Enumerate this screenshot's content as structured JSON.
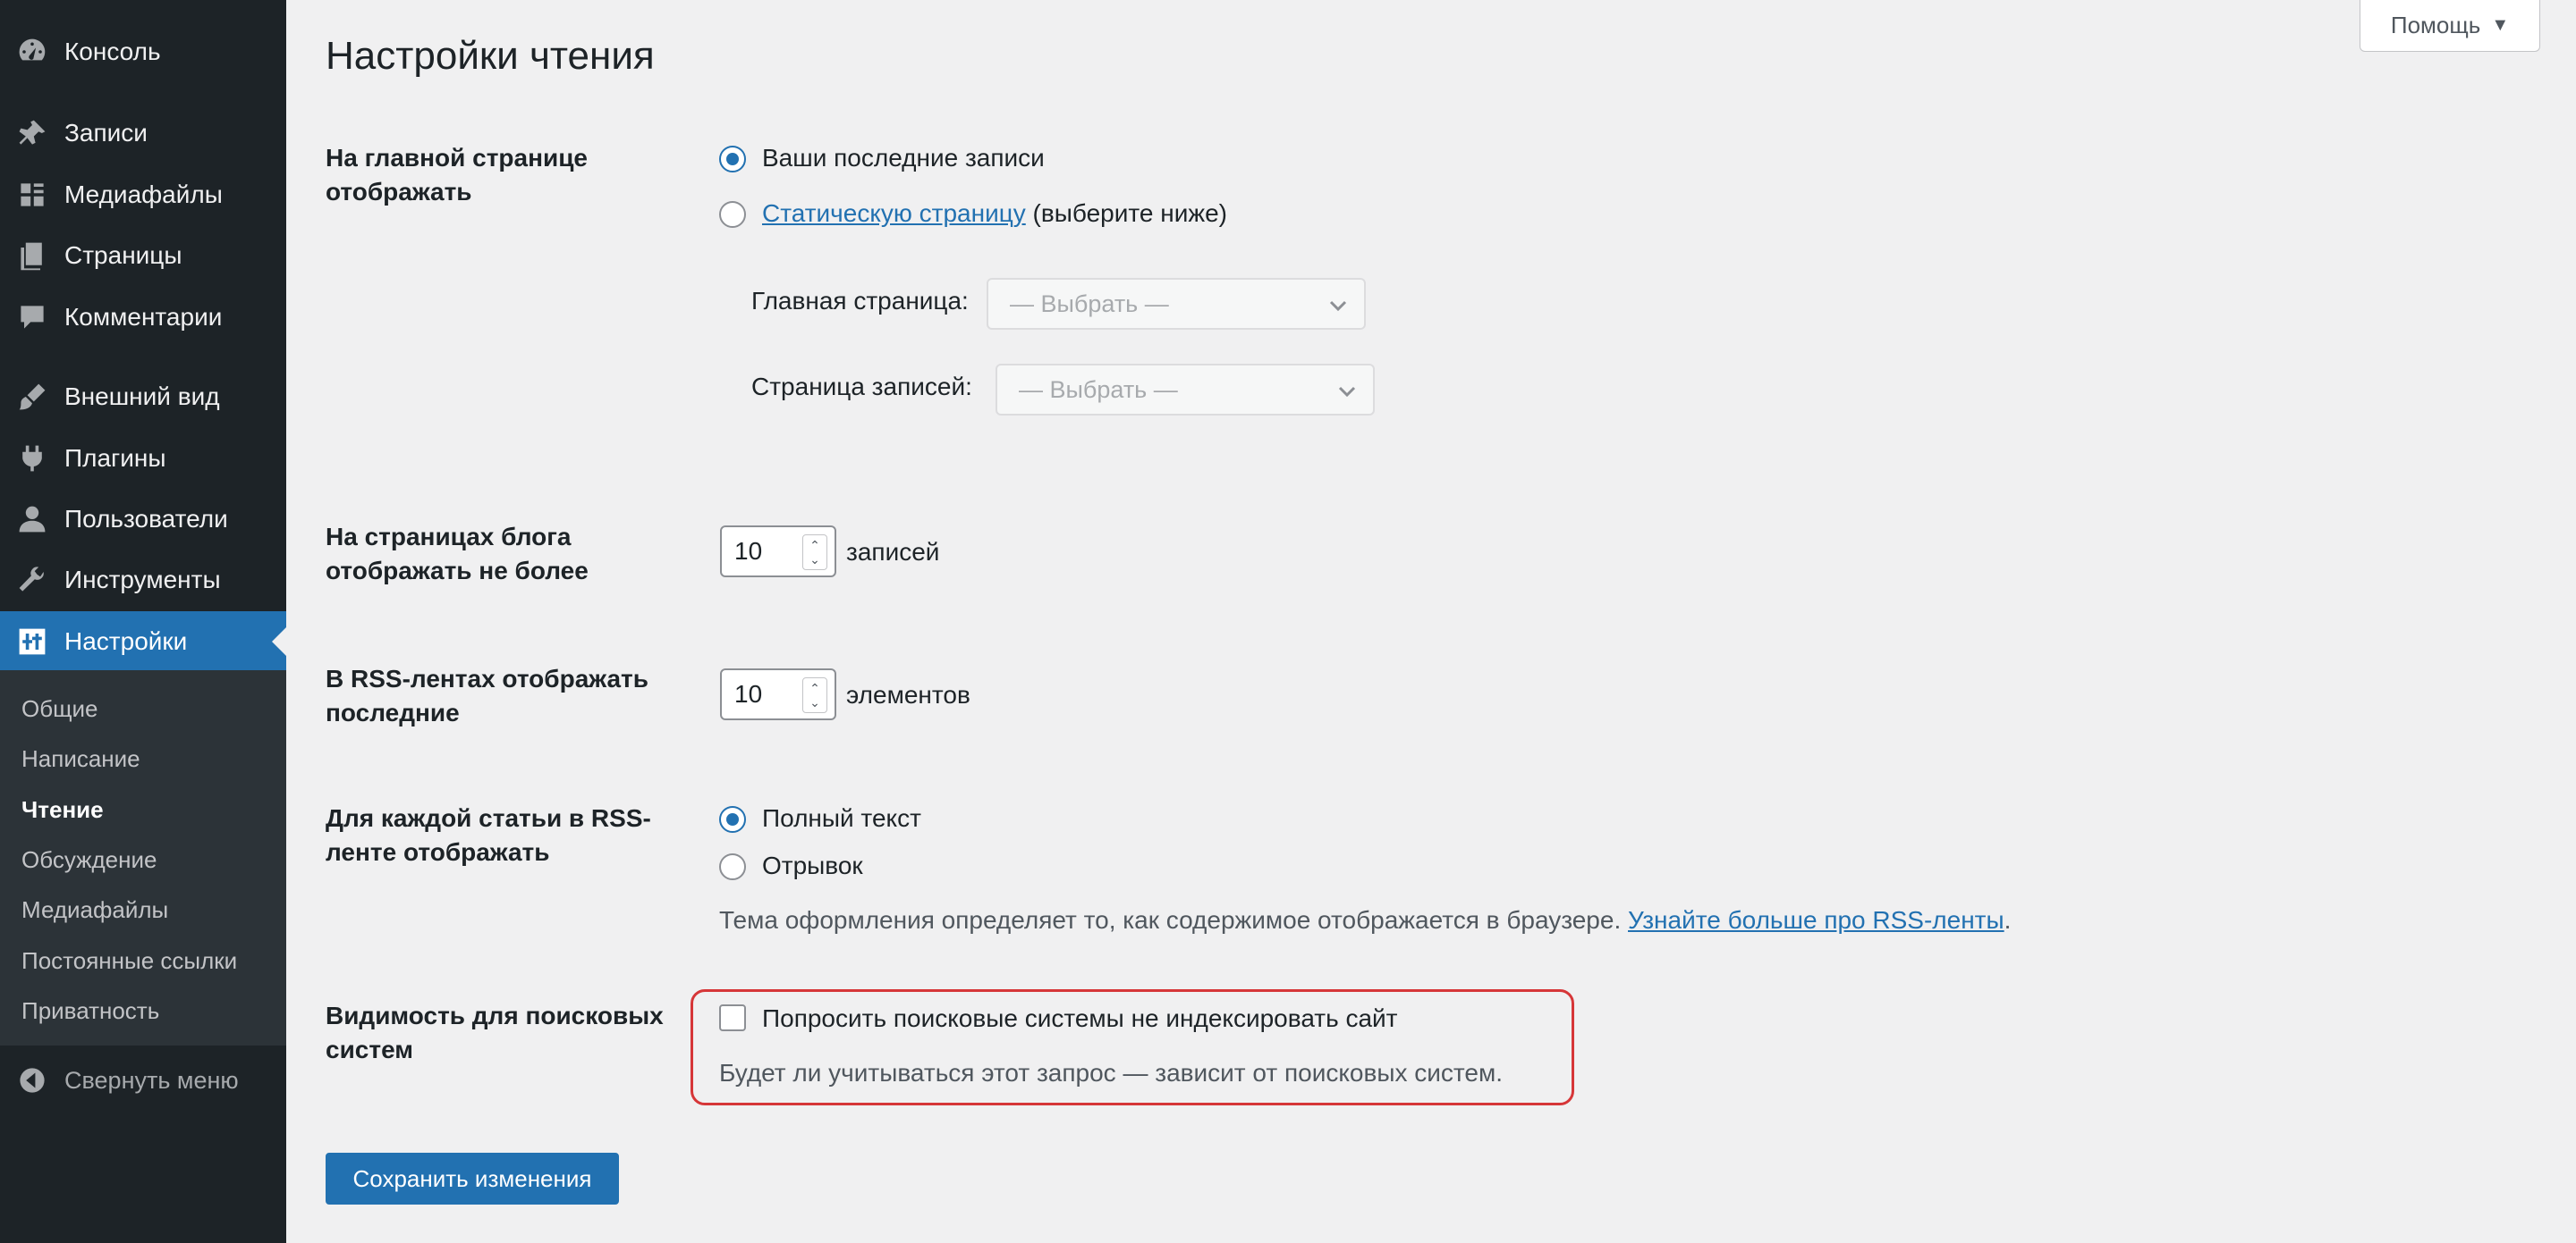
{
  "sidebar": {
    "items": [
      {
        "label": "Консоль",
        "icon": "dashboard-icon"
      },
      {
        "label": "Записи",
        "icon": "pin-icon"
      },
      {
        "label": "Медиафайлы",
        "icon": "media-icon"
      },
      {
        "label": "Страницы",
        "icon": "pages-icon"
      },
      {
        "label": "Комментарии",
        "icon": "comments-icon"
      },
      {
        "label": "Внешний вид",
        "icon": "paintbrush-icon"
      },
      {
        "label": "Плагины",
        "icon": "plugin-icon"
      },
      {
        "label": "Пользователи",
        "icon": "user-icon"
      },
      {
        "label": "Инструменты",
        "icon": "wrench-icon"
      },
      {
        "label": "Настройки",
        "icon": "settings-icon"
      }
    ],
    "submenu": [
      "Общие",
      "Написание",
      "Чтение",
      "Обсуждение",
      "Медиафайлы",
      "Постоянные ссылки",
      "Приватность"
    ],
    "collapse_label": "Свернуть меню"
  },
  "header": {
    "title": "Настройки чтения",
    "help_label": "Помощь",
    "help_caret": "▼"
  },
  "front_page": {
    "label": "На главной странице отображать",
    "option_latest": "Ваши последние записи",
    "option_static_link": "Статическую страницу",
    "option_static_suffix": "(выберите ниже)",
    "homepage_label": "Главная страница:",
    "homepage_select": "— Выбрать —",
    "posts_page_label": "Страница записей:",
    "posts_page_select": "— Выбрать —"
  },
  "posts_per_page": {
    "label": "На страницах блога отображать не более",
    "value": "10",
    "unit": "записей"
  },
  "rss_items": {
    "label": "В RSS-лентах отображать последние",
    "value": "10",
    "unit": "элементов"
  },
  "rss_content": {
    "label": "Для каждой статьи в RSS-ленте отображать",
    "option_full": "Полный текст",
    "option_excerpt": "Отрывок",
    "description": "Тема оформления определяет то, как содержимое отображается в браузере.",
    "link": "Узнайте больше про RSS-ленты",
    "link_suffix": "."
  },
  "search_visibility": {
    "label": "Видимость для поисковых систем",
    "checkbox_label": "Попросить поисковые системы не индексировать сайт",
    "description": "Будет ли учитываться этот запрос — зависит от поисковых систем."
  },
  "save_label": "Сохранить изменения",
  "colors": {
    "sidebar_bg": "#1d2327",
    "submenu_bg": "#2c3338",
    "accent": "#2271b1",
    "highlight": "#d63638",
    "page_bg": "#f0f0f1"
  }
}
